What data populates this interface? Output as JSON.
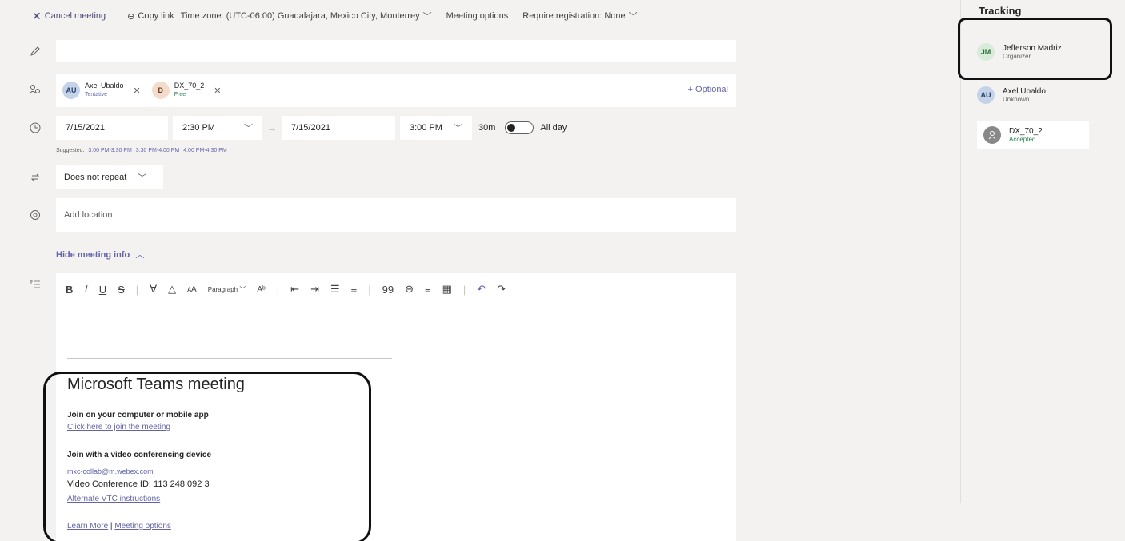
{
  "toolbar": {
    "cancel_label": "Cancel meeting",
    "copy_link_label": "Copy link",
    "timezone_label": "Time zone: (UTC-06:00) Guadalajara, Mexico City, Monterrey",
    "meeting_options_label": "Meeting options",
    "registration_label": "Require registration: None"
  },
  "title_field": {
    "value": ""
  },
  "attendees": [
    {
      "initials": "AU",
      "name": "Axel Ubaldo",
      "status": "Tentative"
    },
    {
      "initials": "D",
      "name": "DX_70_2",
      "status": "Free"
    }
  ],
  "optional_label": "+ Optional",
  "schedule": {
    "start_date": "7/15/2021",
    "start_time": "2:30 PM",
    "end_date": "7/15/2021",
    "end_time": "3:00 PM",
    "duration": "30m",
    "all_day_label": "All day",
    "suggested_label": "Suggested:",
    "suggested_slots": [
      "3:00 PM-3:30 PM",
      "3:30 PM-4:00 PM",
      "4:00 PM-4:30 PM"
    ]
  },
  "repeat": {
    "value": "Does not repeat"
  },
  "location": {
    "placeholder": "Add location"
  },
  "hide_info_label": "Hide meeting info",
  "editor": {
    "format_items": {
      "paragraph": "Paragraph"
    },
    "teams_meeting": {
      "title": "Microsoft Teams meeting",
      "join_computer": "Join on your computer or mobile app",
      "join_link": "Click here to join the meeting",
      "join_device": "Join with a video conferencing device",
      "email": "mxc-collab@m.webex.com",
      "conference_id": "Video Conference ID: 113 248 092 3",
      "vtc_link": "Alternate VTC instructions",
      "learn_more": "Learn More",
      "separator": "|",
      "meeting_options": "Meeting options"
    }
  },
  "tracking": {
    "title": "Tracking",
    "people": [
      {
        "initials": "JM",
        "name": "Jefferson Madriz",
        "role": "Organizer"
      },
      {
        "initials": "AU",
        "name": "Axel Ubaldo",
        "role": "Unknown"
      },
      {
        "initials": "",
        "name": "DX_70_2",
        "role": "Accepted"
      }
    ]
  },
  "colors": {
    "accent": "#6264a7",
    "success": "#237b4b"
  }
}
